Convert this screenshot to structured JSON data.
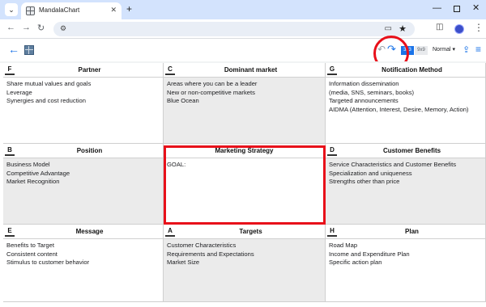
{
  "browser": {
    "tab_title": "MandalaChart",
    "tab_search_icon": "chevron-down-icon",
    "new_tab_label": "+",
    "close_label": "✕"
  },
  "toolbar": {
    "view_3x3": "3x3",
    "view_9x9": "9x9",
    "size": "Normal"
  },
  "cells": [
    {
      "letter": "F",
      "title": "Partner",
      "lines": [
        "Share mutual values and goals",
        "Leverage",
        "Synergies and cost reduction"
      ]
    },
    {
      "letter": "C",
      "title": "Dominant market",
      "lines": [
        "Areas where you can be a leader",
        "New or non-competitive markets",
        "Blue Ocean"
      ]
    },
    {
      "letter": "G",
      "title": "Notification Method",
      "lines": [
        "Information dissemination",
        "(media, SNS, seminars, books)",
        "Targeted announcements",
        "AIDMA (Attention, Interest, Desire, Memory, Action)"
      ]
    },
    {
      "letter": "B",
      "title": "Position",
      "lines": [
        "Business Model",
        "Competitive Advantage",
        "Market Recognition"
      ]
    },
    {
      "letter": "",
      "title": "Marketing Strategy",
      "lines": [
        "GOAL:"
      ]
    },
    {
      "letter": "D",
      "title": "Customer Benefits",
      "lines": [
        "Service Characteristics and Customer Benefits",
        "Specialization and uniqueness",
        "Strengths other than price"
      ]
    },
    {
      "letter": "E",
      "title": "Message",
      "lines": [
        "Benefits to Target",
        "Consistent content",
        "Stimulus to customer behavior"
      ]
    },
    {
      "letter": "A",
      "title": "Targets",
      "lines": [
        "Customer Characteristics",
        "Requirements and Expectations",
        "Market Size"
      ]
    },
    {
      "letter": "H",
      "title": "Plan",
      "lines": [
        "Road Map",
        "Income and Expenditure Plan",
        "Specific action plan"
      ]
    }
  ],
  "colors": {
    "accent": "#1a73e8",
    "highlight": "#e8101a",
    "shaded": "#ebebeb"
  }
}
